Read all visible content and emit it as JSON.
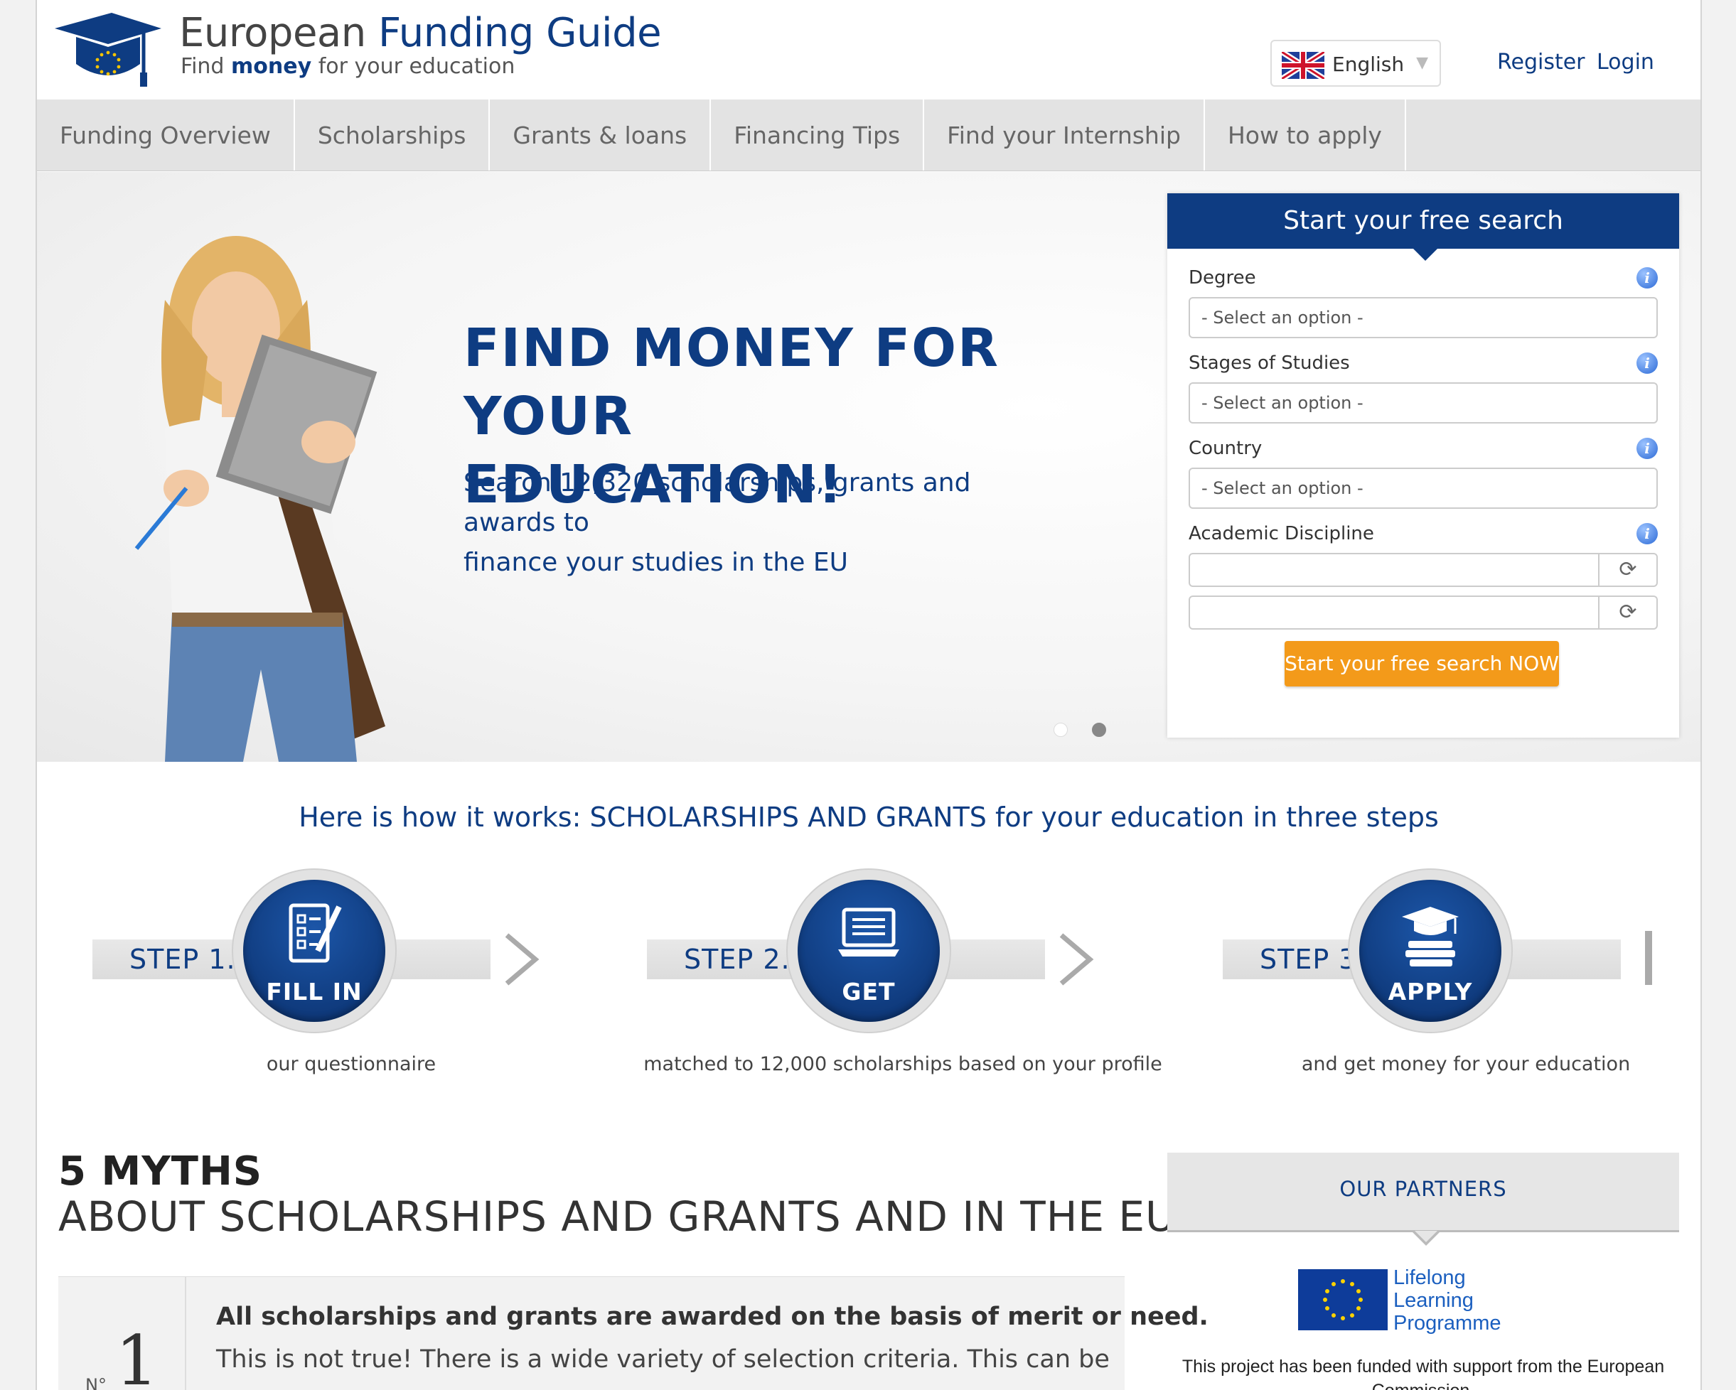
{
  "header": {
    "logo_title_a": "European ",
    "logo_title_b": "Funding Guide",
    "logo_tag_a": "Find ",
    "logo_tag_b": "money",
    "logo_tag_c": " for your education",
    "language": "English",
    "register": "Register",
    "login": "Login"
  },
  "nav": [
    "Funding Overview",
    "Scholarships",
    "Grants & loans",
    "Financing Tips",
    "Find your Internship",
    "How to apply"
  ],
  "hero": {
    "headline_1": "FIND MONEY FOR",
    "headline_2": "YOUR EDUCATION!",
    "sub_1": "Search 12,320 scholarships, grants and awards to",
    "sub_2": "finance your studies in the EU"
  },
  "search": {
    "title": "Start your free search",
    "fields": [
      {
        "label": "Degree",
        "placeholder": "- Select an option -"
      },
      {
        "label": "Stages of Studies",
        "placeholder": "- Select an option -"
      },
      {
        "label": "Country",
        "placeholder": "- Select an option -"
      },
      {
        "label": "Academic Discipline"
      }
    ],
    "button": "Start your free search NOW"
  },
  "how": {
    "title": "Here is how it works: SCHOLARSHIPS AND GRANTS for your education in three steps",
    "steps": [
      {
        "label": "STEP 1.",
        "word": "FILL IN",
        "caption": "our questionnaire"
      },
      {
        "label": "STEP 2.",
        "word": "GET",
        "caption": "matched to 12,000 scholarships based on your profile"
      },
      {
        "label": "STEP 3.",
        "word": "APPLY",
        "caption": "and get money for your education"
      }
    ]
  },
  "myths": {
    "heading": "5 MYTHS",
    "subheading": "ABOUT SCHOLARSHIPS AND GRANTS AND IN THE EU",
    "item": {
      "no": "N°",
      "number": "1",
      "bold": "All scholarships and grants are awarded on the basis of merit or need.",
      "text": "This is not true! There is a wide variety of selection criteria. This can be"
    }
  },
  "partners": {
    "title": "OUR PARTNERS",
    "llp_1": "Lifelong",
    "llp_2": "Learning",
    "llp_3": "Programme",
    "funded": "This project has been funded with support from the European Commission."
  },
  "colors": {
    "brand_blue": "#0e3c82",
    "accent_orange": "#f39a1a"
  }
}
